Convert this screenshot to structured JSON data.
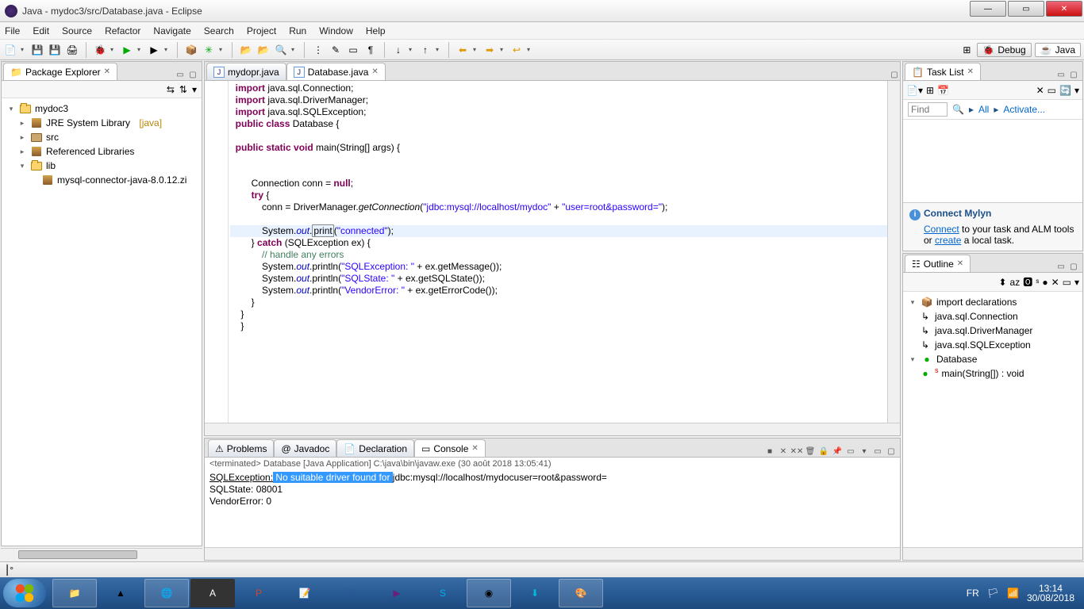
{
  "window": {
    "title": "Java - mydoc3/src/Database.java - Eclipse"
  },
  "menus": [
    "File",
    "Edit",
    "Source",
    "Refactor",
    "Navigate",
    "Search",
    "Project",
    "Run",
    "Window",
    "Help"
  ],
  "perspective": {
    "debug": "Debug",
    "java": "Java"
  },
  "package_explorer": {
    "title": "Package Explorer",
    "project": "mydoc3",
    "jre": "JRE System Library",
    "jre_suffix": "[java]",
    "src": "src",
    "ref": "Referenced Libraries",
    "lib": "lib",
    "jar": "mysql-connector-java-8.0.12.zi"
  },
  "editor": {
    "tab1": "mydopr.java",
    "tab2": "Database.java",
    "code_lines": [
      {
        "t": "import",
        "kw": "import",
        "rest": " java.sql.Connection;"
      },
      {
        "t": "import",
        "kw": "import",
        "rest": " java.sql.DriverManager;"
      },
      {
        "t": "import",
        "kw": "import",
        "rest": " java.sql.SQLException;"
      },
      {
        "t": "class",
        "pre": "public class",
        "name": " Database {"
      },
      {
        "t": "blank"
      },
      {
        "t": "main",
        "pre": "public static void",
        "name": " main(String[] args) {"
      },
      {
        "t": "blank"
      },
      {
        "t": "blank"
      },
      {
        "t": "conn",
        "text": "        Connection conn = ",
        "kw": "null",
        "tail": ";"
      },
      {
        "t": "try",
        "kw": "try",
        "tail": " {"
      },
      {
        "t": "get",
        "pre": "            conn = DriverManager.",
        "m": "getConnection",
        "open": "(",
        "s1": "\"jdbc:mysql://localhost/mydoc\"",
        "plus": " + ",
        "s2": "\"user=root&password=\"",
        "close": ");"
      },
      {
        "t": "blank"
      },
      {
        "t": "print",
        "pre": "            System.",
        "fld": "out",
        "dot": ".",
        "box": "print",
        "open": "(",
        "s": "\"connected\"",
        "close": ");",
        "hl": true
      },
      {
        "t": "catch",
        "pre": "        } ",
        "kw": "catch",
        "tail": " (SQLException ex) {"
      },
      {
        "t": "comment",
        "text": "            // handle any errors"
      },
      {
        "t": "p1",
        "pre": "            System.",
        "fld": "out",
        "dot": ".println(",
        "s": "\"SQLException: \"",
        "tail": " + ex.getMessage());"
      },
      {
        "t": "p2",
        "pre": "            System.",
        "fld": "out",
        "dot": ".println(",
        "s": "\"SQLState: \"",
        "tail": " + ex.getSQLState());"
      },
      {
        "t": "p3",
        "pre": "            System.",
        "fld": "out",
        "dot": ".println(",
        "s": "\"VendorError: \"",
        "tail": " + ex.getErrorCode());"
      },
      {
        "t": "close1",
        "text": "        }"
      },
      {
        "t": "close2",
        "text": "    }"
      },
      {
        "t": "close3",
        "text": "    }"
      }
    ]
  },
  "task_list": {
    "title": "Task List",
    "find": "Find",
    "all": "All",
    "activate": "Activate...",
    "mylyn_title": "Connect Mylyn",
    "mylyn_text1": " to your task and ALM tools or ",
    "mylyn_connect": "Connect",
    "mylyn_create": "create",
    "mylyn_text2": " a local task."
  },
  "outline": {
    "title": "Outline",
    "import_decl": "import declarations",
    "i1": "java.sql.Connection",
    "i2": "java.sql.DriverManager",
    "i3": "java.sql.SQLException",
    "cls": "Database",
    "main": "main(String[]) : void"
  },
  "bottom": {
    "problems": "Problems",
    "javadoc": "Javadoc",
    "declaration": "Declaration",
    "console": "Console",
    "status": "<terminated> Database [Java Application] C:\\java\\bin\\javaw.exe (30 août 2018 13:05:41)",
    "line1_a": "SQLException:",
    "line1_sel": " No suitable driver found for ",
    "line1_b": "jdbc:mysql://localhost/mydocuser=root&password=",
    "line2": "SQLState: 08001",
    "line3": "VendorError: 0"
  },
  "taskbar": {
    "lang": "FR",
    "time": "13:14",
    "date": "30/08/2018"
  }
}
